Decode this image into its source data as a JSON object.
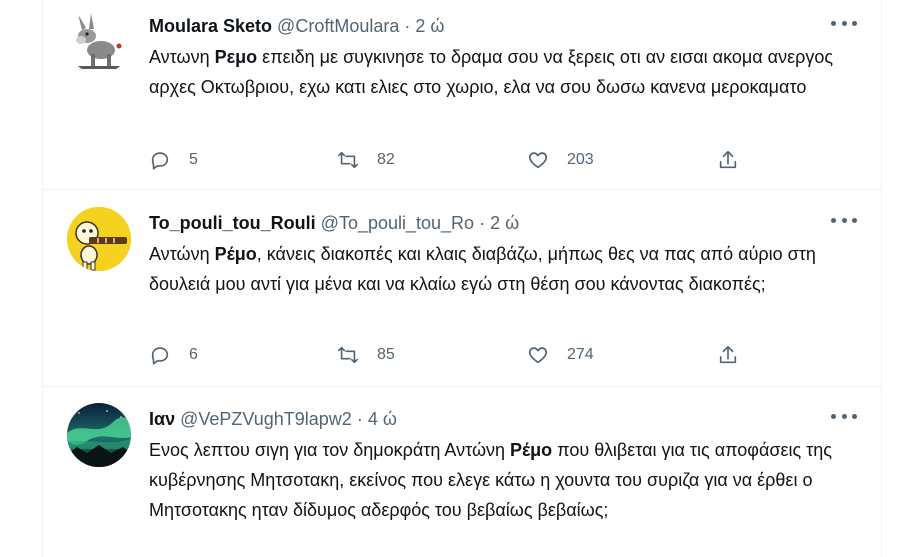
{
  "tweets": [
    {
      "name": "Moulara Sketo",
      "handle": "@CroftMoulara",
      "separator": "·",
      "time": "2 ώ",
      "text_pre": "Αντωνη ",
      "text_bold": "Ρεμο",
      "text_post": " επειδη με συγκινησε το δραμα σου να ξερεις οτι αν εισαι ακομα ανεργος αρχες Οκτωβριου, εχω κατι ελιες στο χωριο, ελα να σου δωσω κανενα μεροκαματο",
      "replies": "5",
      "retweets": "82",
      "likes": "203",
      "avatar_icon": "donkey-cartoon-icon"
    },
    {
      "name": "To_pouli_tou_Rouli",
      "handle": "@To_pouli_tou_Ro",
      "separator": "·",
      "time": "2 ώ",
      "text_pre": "Αντώνη ",
      "text_bold": "Ρέμο",
      "text_post": ", κάνεις διακοπές και κλαις διαβάζω, μήπως θες να πας από αύριο στη δουλειά μου αντί για μένα και να κλαίω εγώ στη θέση σου κάνοντας διακοπές;",
      "replies": "6",
      "retweets": "85",
      "likes": "274",
      "avatar_icon": "yellow-cartoon-icon"
    },
    {
      "name": "Ιαν",
      "handle": "@VePZVughT9lapw2",
      "separator": "·",
      "time": "4 ώ",
      "text_pre": "Ενος λεπτου σιγη για τον δημοκράτη Αντώνη ",
      "text_bold": "Ρέμο",
      "text_post": " που  θλιβεται για τις αποφάσεις της κυβέρνησης Μητσοτακη, εκείνος που ελεγε κάτω η χουντα του συριζα για να έρθει ο Μητσοτακης ηταν δίδυμος αδερφός του βεβαίως βεβαίως;",
      "avatar_icon": "aurora-landscape-icon"
    }
  ],
  "colors": {
    "text": "#0f1419",
    "secondary": "#536471",
    "divider": "#eff3f4"
  }
}
